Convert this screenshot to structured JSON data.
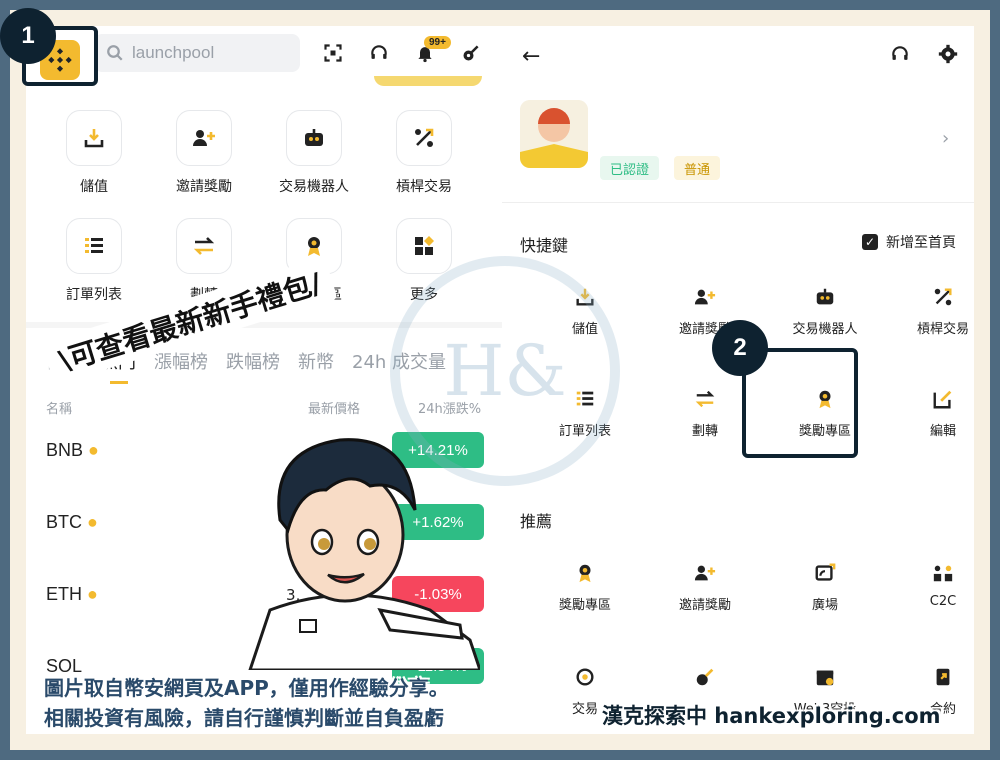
{
  "search": {
    "placeholder": "launchpool"
  },
  "header": {
    "notification_badge": "99+"
  },
  "left_grid": [
    {
      "label": "儲值",
      "icon": "deposit-icon"
    },
    {
      "label": "邀請獎勵",
      "icon": "invite-icon"
    },
    {
      "label": "交易機器人",
      "icon": "bot-icon"
    },
    {
      "label": "槓桿交易",
      "icon": "margin-icon"
    },
    {
      "label": "訂單列表",
      "icon": "orders-icon"
    },
    {
      "label": "劃轉",
      "icon": "transfer-icon"
    },
    {
      "label": "獎勵專區",
      "icon": "reward-icon"
    },
    {
      "label": "更多",
      "icon": "more-icon"
    }
  ],
  "market_tabs": [
    "自選",
    "熱門",
    "漲幅榜",
    "跌幅榜",
    "新幣",
    "24h 成交量"
  ],
  "market_cols": {
    "name": "名稱",
    "price": "最新價格",
    "change": "24h漲跌%"
  },
  "coins": [
    {
      "symbol": "BNB",
      "change": "+14.21%",
      "dir": "up"
    },
    {
      "symbol": "BTC",
      "change": "+1.62%",
      "dir": "up"
    },
    {
      "symbol": "ETH",
      "change": "-1.03%",
      "dir": "down"
    },
    {
      "symbol": "SOL",
      "change": "+11.54%",
      "dir": "up"
    }
  ],
  "visible_price_fragment": "3,",
  "banner": "\\可查看最新新手禮包/",
  "profile": {
    "verified": "已認證",
    "level": "普通"
  },
  "shortcuts": {
    "title": "快捷鍵",
    "add_home": "新增至首頁",
    "items": [
      {
        "label": "儲值",
        "icon": "deposit-icon"
      },
      {
        "label": "邀請獎勵",
        "icon": "invite-icon"
      },
      {
        "label": "交易機器人",
        "icon": "bot-icon"
      },
      {
        "label": "槓桿交易",
        "icon": "margin-icon"
      },
      {
        "label": "訂單列表",
        "icon": "orders-icon"
      },
      {
        "label": "劃轉",
        "icon": "transfer-icon"
      },
      {
        "label": "獎勵專區",
        "icon": "reward-icon"
      },
      {
        "label": "編輯",
        "icon": "edit-icon"
      }
    ]
  },
  "recommend": {
    "title": "推薦",
    "items": [
      {
        "label": "獎勵專區",
        "icon": "reward-icon"
      },
      {
        "label": "邀請獎勵",
        "icon": "invite-icon"
      },
      {
        "label": "廣場",
        "icon": "square-icon"
      },
      {
        "label": "C2C",
        "icon": "c2c-icon"
      },
      {
        "label": "交易",
        "icon": "trade-icon"
      },
      {
        "label": "",
        "icon": "pay-icon"
      },
      {
        "label": "Web3空投",
        "icon": "airdrop-icon"
      },
      {
        "label": "合約",
        "icon": "futures-icon"
      }
    ]
  },
  "steps": [
    "1",
    "2"
  ],
  "caption": {
    "line1": "圖片取自幣安網頁及APP，僅用作經驗分享。",
    "line2": "相關投資有風險，請自行謹慎判斷並自負盈虧"
  },
  "site": "漢克探索中 hankexploring.com",
  "colors": {
    "brand": "#f3ba2f",
    "up": "#2ebd85",
    "down": "#f6465d",
    "frame": "#4e6a80",
    "step": "#0e2230"
  }
}
